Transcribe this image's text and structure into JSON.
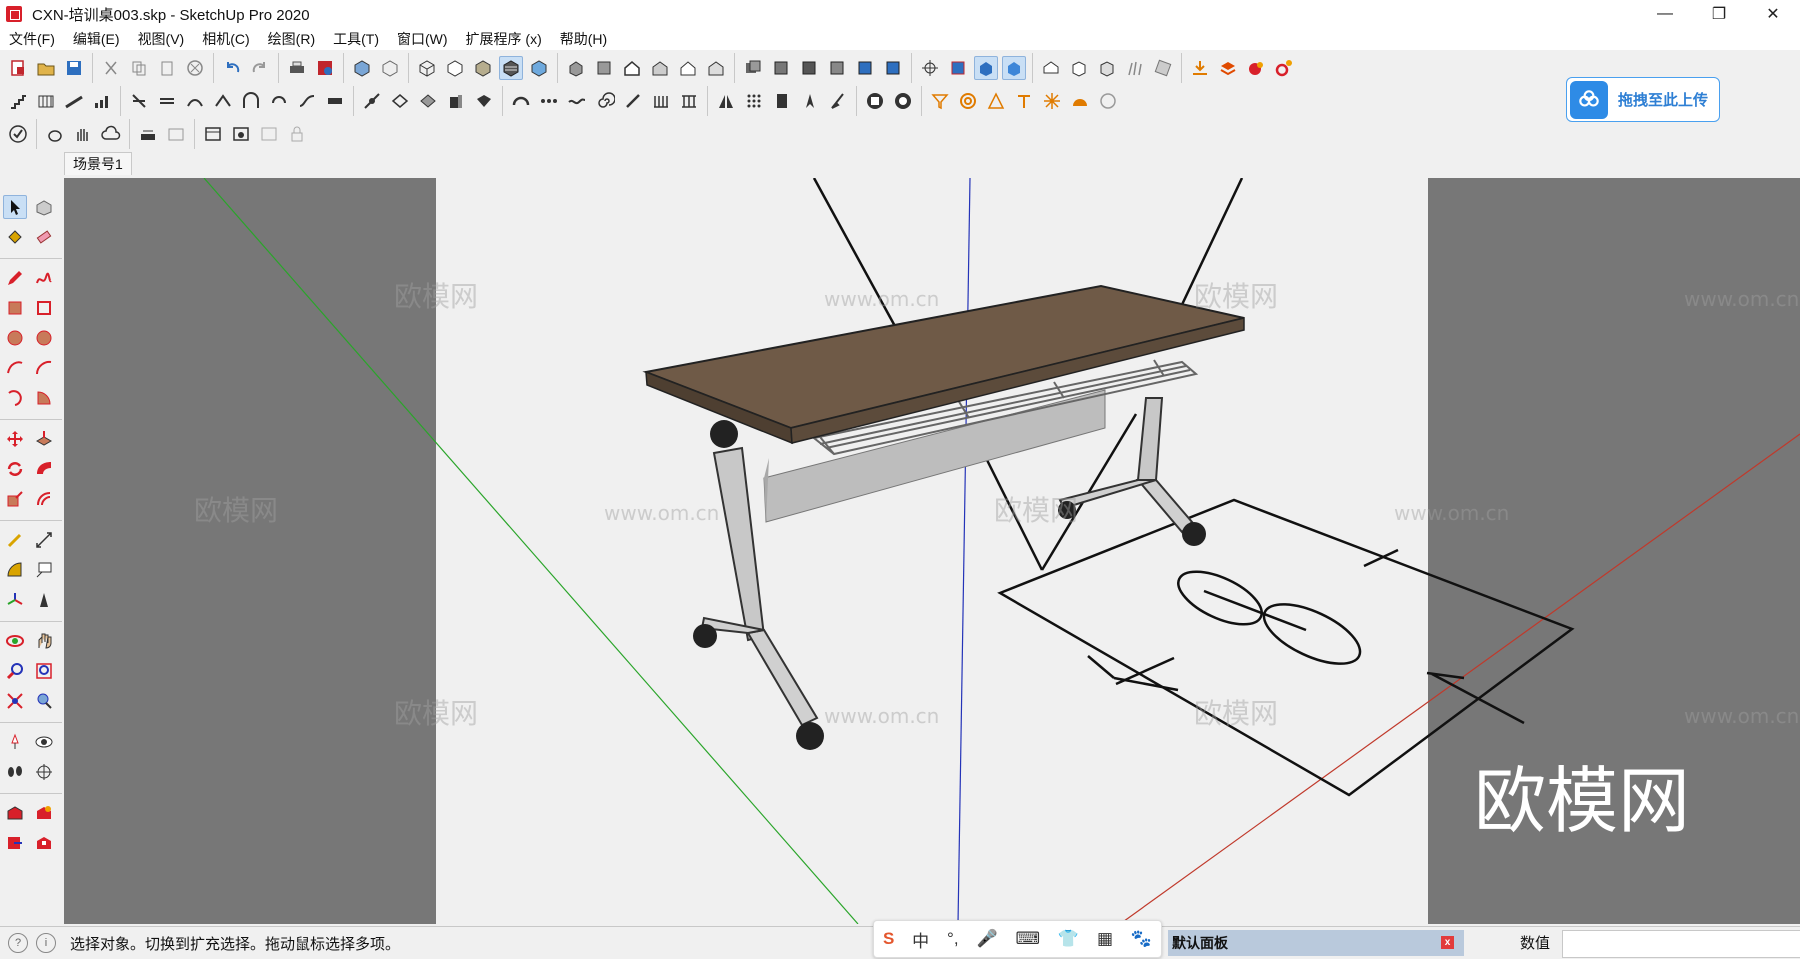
{
  "window": {
    "title": "CXN-培训桌003.skp - SketchUp Pro 2020",
    "controls": [
      "—",
      "❐",
      "✕"
    ]
  },
  "menu": [
    "文件(F)",
    "编辑(E)",
    "视图(V)",
    "相机(C)",
    "绘图(R)",
    "工具(T)",
    "窗口(W)",
    "扩展程序 (x)",
    "帮助(H)"
  ],
  "upload_button": {
    "label": "拖拽至此上传"
  },
  "scene_tab": "场景号1",
  "status": {
    "hint": "选择对象。切换到扩充选择。拖动鼠标选择多项。"
  },
  "ime": {
    "items": [
      "S",
      "中",
      "°,",
      "🎤",
      "⌨",
      "👕",
      "▦",
      "🐾"
    ]
  },
  "panel": {
    "label": "默认面板",
    "close": "x"
  },
  "measurements": {
    "label": "数值",
    "value": ""
  },
  "watermarks": {
    "brand": "欧模网",
    "url": "www.om.cn"
  },
  "colors": {
    "viewport_bg": "#777777",
    "canvas_bg": "#f0f0f0",
    "tabletop": "#6f5a47",
    "axis_red": "#c0392b",
    "axis_green": "#2aa52a",
    "axis_blue": "#2433b8",
    "accent": "#2e8be6"
  }
}
